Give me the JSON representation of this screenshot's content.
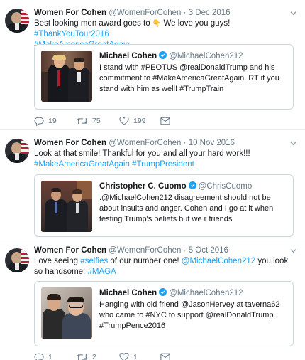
{
  "tweets": [
    {
      "name": "Women For Cohen",
      "handle": "@WomenForCohen",
      "sep": " · ",
      "date": "3 Dec 2016",
      "text_a": "Best looking men award goes to ",
      "emoji": "👇",
      "text_b": " We love you guys! ",
      "tag1": "#ThankYouTour2016",
      "tag2": "#MakeAmericaGreatAgain",
      "quote": {
        "name": "Michael Cohen",
        "handle": "@MichaelCohen212",
        "text": "I stand with #PEOTUS @realDonaldTrump and his commitment to #MakeAmericaGreatAgain. RT if you stand with him as well! #TrumpTrain"
      },
      "replies": "19",
      "retweets": "75",
      "likes": "199"
    },
    {
      "name": "Women For Cohen",
      "handle": "@WomenForCohen",
      "sep": " · ",
      "date": "10 Nov 2016",
      "text_a": "Look at that smile! Thankful for you and all your hard work!!!",
      "tag1": "#MakeAmericaGreatAgain",
      "tag2": "#TrumpPresident",
      "quote": {
        "name": "Christopher C. Cuomo",
        "handle": "@ChrisCuomo",
        "text": ".@MichaelCohen212 disagreement should not be about insults and anger. Cohen and I go at it when testing Trump's  beliefs but we r friends"
      }
    },
    {
      "name": "Women For Cohen",
      "handle": "@WomenForCohen",
      "sep": " · ",
      "date": "5 Oct 2016",
      "text_a": "Love seeing ",
      "tag_selfies": "#selfies",
      "text_b": " of our number one! ",
      "mention": "@MichaelCohen212",
      "text_c": " you look so handsome! ",
      "tag_maga": "#MAGA",
      "quote": {
        "name": "Michael Cohen",
        "handle": "@MichaelCohen212",
        "text": "Hanging with old friend @JasonHervey at taverna62 who came to #NYC to support @realDonaldTrump. #TrumpPence2016"
      },
      "replies": "1",
      "retweets": "2",
      "likes": "1"
    }
  ],
  "icons": {
    "reply": "reply-icon",
    "retweet": "retweet-icon",
    "like": "heart-icon",
    "message": "envelope-icon",
    "more": "chevron-down-icon",
    "verified": "verified-badge-icon"
  },
  "colors": {
    "link": "#1da1f2",
    "text": "#14171a",
    "muted": "#657786",
    "border": "#ccd6dd"
  }
}
